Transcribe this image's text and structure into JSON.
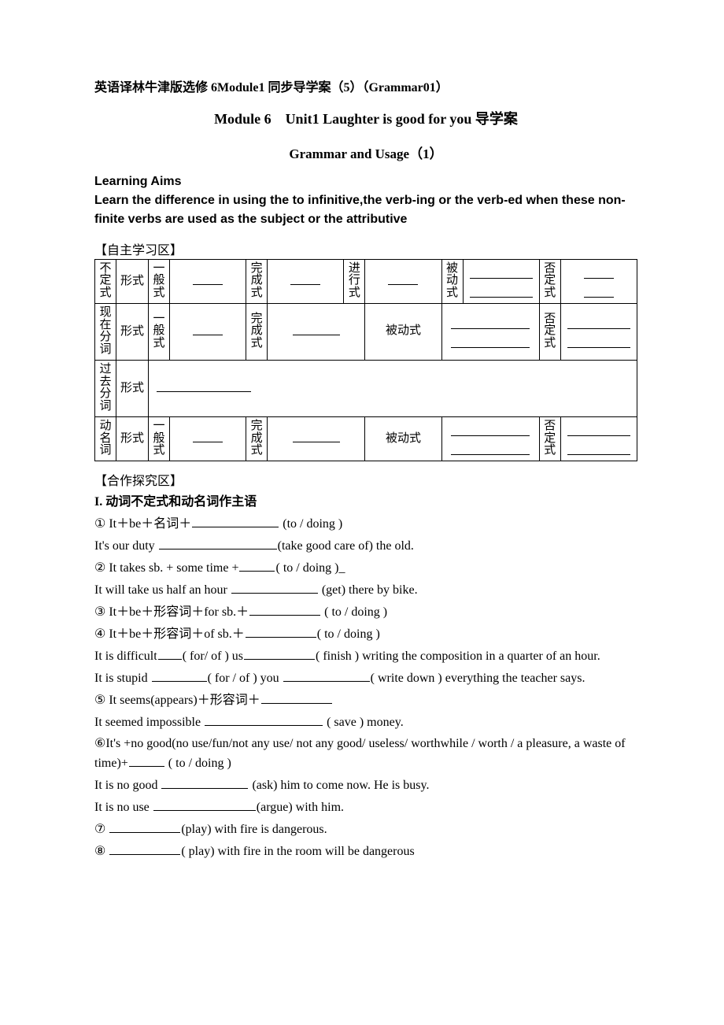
{
  "doc_title": "英语译林牛津版选修 6Module1 同步导学案（5）（Grammar01）",
  "subtitle": "Module 6　Unit1 Laughter is good for you 导学案",
  "section_title": "Grammar and Usage（1）",
  "learning_aims_header": "Learning Aims",
  "learning_aims_body": "Learn the difference in using the to infinitive,the verb-ing or the verb-ed when these non-finite verbs are used as the subject or the attributive",
  "zone_study": "【自主学习区】",
  "zone_coop": "【合作探究区】",
  "table": {
    "r1c1": "不定式",
    "r1c2": "形式",
    "r1c3": "一般式",
    "r1c4": "完成式",
    "r1c5": "进行式",
    "r1c6": "被动式",
    "r1c7": "否定式",
    "r2c1": "现在分词",
    "r2c2": "形式",
    "r2c3": "一般式",
    "r2c4": "完成式",
    "r2c5": "被动式",
    "r2c6": "否定式",
    "r3c1": "过去分词",
    "r3c2": "形式",
    "r4c1": "动名词",
    "r4c2": "形式",
    "r4c3": "一般式",
    "r4c4": "完成式",
    "r4c5": "被动式",
    "r4c6": "否定式"
  },
  "sec1_hdr": "I. 动词不定式和动名词作主语",
  "s1_l1a": "① It＋be＋名词＋",
  "s1_l1b": " (to / doing )",
  "s1_l2a": " It's our duty ",
  "s1_l2b": "(take good care of) the old.",
  "s1_l3a": "② It takes sb. + some time +",
  "s1_l3b": "( to / doing )_",
  "s1_l4a": "It will take us half an hour ",
  "s1_l4b": " (get) there by bike.",
  "s1_l5a": "③ It＋be＋形容词＋for sb.＋",
  "s1_l5b": " ( to / doing )",
  "s1_l6a": "④ It＋be＋形容词＋of sb.＋",
  "s1_l6b": "( to / doing )",
  "s1_l7a": "It is difficult",
  "s1_l7b": "( for/ of ) us",
  "s1_l7c": "( finish ) writing the composition in a quarter of an hour.",
  "s1_l8a": "It is stupid ",
  "s1_l8b": "( for / of ) you ",
  "s1_l8c": "( write down ) everything the teacher says.",
  "s1_l9a": "⑤ It seems(appears)＋形容词＋",
  "s1_l10a": "It seemed impossible ",
  "s1_l10b": " ( save ) money.",
  "s1_l11": "⑥It's +no good(no use/fun/not any use/ not any good/ useless/ worthwhile / worth / a pleasure, a waste of time)+",
  "s1_l11b": " ( to / doing )",
  "s1_l12a": "It is no good ",
  "s1_l12b": " (ask) him to come now. He is busy.",
  "s1_l13a": "It is no use ",
  "s1_l13b": "(argue) with him.",
  "s1_l14a": "⑦ ",
  "s1_l14b": "(play) with fire is dangerous.",
  "s1_l15a": "⑧ ",
  "s1_l15b": "( play) with fire in the room will be dangerous"
}
